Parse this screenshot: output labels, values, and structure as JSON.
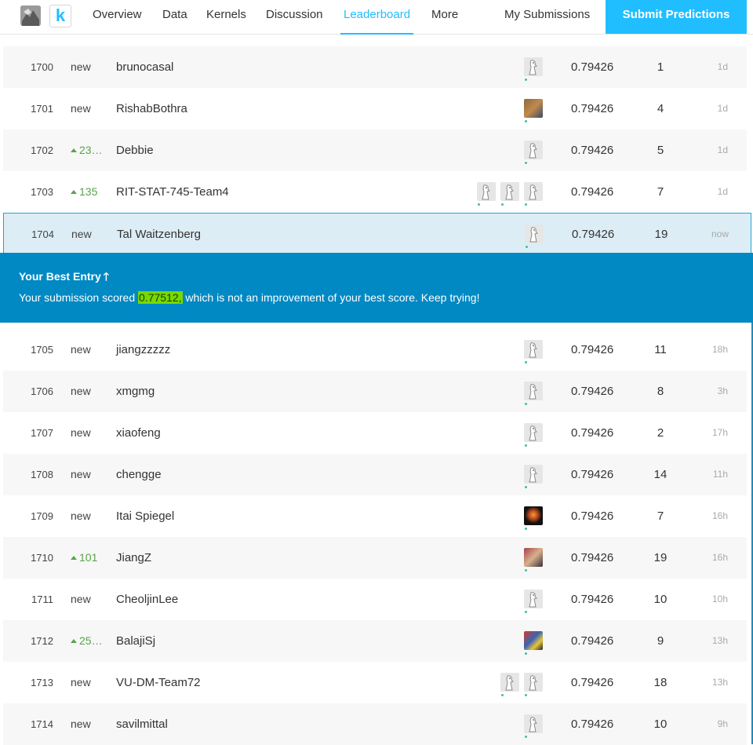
{
  "nav": {
    "k_logo": "k",
    "items": [
      "Overview",
      "Data",
      "Kernels",
      "Discussion",
      "Leaderboard",
      "More"
    ],
    "active": "Leaderboard",
    "my_submissions": "My Submissions",
    "submit": "Submit Predictions"
  },
  "banner": {
    "title": "Your Best Entry",
    "arrow": "🡑",
    "msg_before": "Your submission scored ",
    "score": "0.77512,",
    "msg_after": " which is not an improvement of your best score. Keep trying!"
  },
  "rows": [
    {
      "rank": "1700",
      "change": "new",
      "up": false,
      "team": "brunocasal",
      "avatars": [
        "default"
      ],
      "score": "0.79426",
      "entries": "1",
      "last": "1d"
    },
    {
      "rank": "1701",
      "change": "new",
      "up": false,
      "team": "RishabBothra",
      "avatars": [
        "photo-1"
      ],
      "score": "0.79426",
      "entries": "4",
      "last": "1d"
    },
    {
      "rank": "1702",
      "change": "23…",
      "up": true,
      "team": "Debbie",
      "avatars": [
        "default"
      ],
      "score": "0.79426",
      "entries": "5",
      "last": "1d"
    },
    {
      "rank": "1703",
      "change": "135",
      "up": true,
      "team": "RIT-STAT-745-Team4",
      "avatars": [
        "default",
        "default",
        "default"
      ],
      "score": "0.79426",
      "entries": "7",
      "last": "1d"
    },
    {
      "rank": "1704",
      "change": "new",
      "up": false,
      "team": "Tal Waitzenberg",
      "avatars": [
        "default"
      ],
      "score": "0.79426",
      "entries": "19",
      "last": "now",
      "me": true
    },
    {
      "rank": "1705",
      "change": "new",
      "up": false,
      "team": "jiangzzzzz",
      "avatars": [
        "default"
      ],
      "score": "0.79426",
      "entries": "11",
      "last": "18h"
    },
    {
      "rank": "1706",
      "change": "new",
      "up": false,
      "team": "xmgmg",
      "avatars": [
        "default"
      ],
      "score": "0.79426",
      "entries": "8",
      "last": "3h"
    },
    {
      "rank": "1707",
      "change": "new",
      "up": false,
      "team": "xiaofeng",
      "avatars": [
        "default"
      ],
      "score": "0.79426",
      "entries": "2",
      "last": "17h"
    },
    {
      "rank": "1708",
      "change": "new",
      "up": false,
      "team": "chengge",
      "avatars": [
        "default"
      ],
      "score": "0.79426",
      "entries": "14",
      "last": "11h"
    },
    {
      "rank": "1709",
      "change": "new",
      "up": false,
      "team": "Itai Spiegel",
      "avatars": [
        "photo-2"
      ],
      "score": "0.79426",
      "entries": "7",
      "last": "16h"
    },
    {
      "rank": "1710",
      "change": "101",
      "up": true,
      "team": "JiangZ",
      "avatars": [
        "photo-3"
      ],
      "score": "0.79426",
      "entries": "19",
      "last": "16h"
    },
    {
      "rank": "1711",
      "change": "new",
      "up": false,
      "team": "CheoljinLee",
      "avatars": [
        "default"
      ],
      "score": "0.79426",
      "entries": "10",
      "last": "10h"
    },
    {
      "rank": "1712",
      "change": "25…",
      "up": true,
      "team": "BalajiSj",
      "avatars": [
        "photo-4"
      ],
      "score": "0.79426",
      "entries": "9",
      "last": "13h"
    },
    {
      "rank": "1713",
      "change": "new",
      "up": false,
      "team": "VU-DM-Team72",
      "avatars": [
        "default",
        "default"
      ],
      "score": "0.79426",
      "entries": "18",
      "last": "13h"
    },
    {
      "rank": "1714",
      "change": "new",
      "up": false,
      "team": "savilmittal",
      "avatars": [
        "default"
      ],
      "score": "0.79426",
      "entries": "10",
      "last": "9h"
    }
  ],
  "colors": {
    "accent": "#20beff",
    "banner": "#0089c3",
    "highlight": "#77d900",
    "up": "#59a24b"
  }
}
